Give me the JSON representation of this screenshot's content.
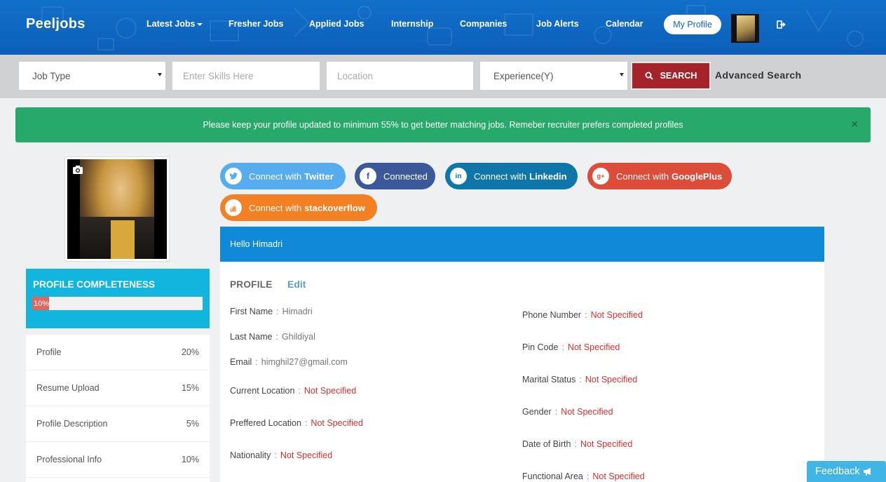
{
  "nav": {
    "brand": "Peeljobs",
    "items": [
      "Latest Jobs",
      "Fresher Jobs",
      "Applied Jobs",
      "Internship",
      "Companies",
      "Job Alerts",
      "Calendar"
    ],
    "active": "My Profile",
    "icons": {
      "logout": "logout-icon",
      "dropdown": "caret-down-icon"
    }
  },
  "search": {
    "job_type": "Job Type",
    "skills_placeholder": "Enter Skills Here",
    "location_placeholder": "Location",
    "experience": "Experience(Y)",
    "button": "SEARCH",
    "advanced": "Advanced Search",
    "button_color": "#a5232a"
  },
  "alert": {
    "message": "Please keep your profile updated to minimum 55% to get better matching jobs. Remeber recruiter prefers completed profiles",
    "close": "×",
    "color": "#27a96b"
  },
  "completeness": {
    "title": "PROFILE COMPLETENESS",
    "percent_label": "10%",
    "percent": 10,
    "color": "#12b5dd"
  },
  "progress_items": [
    {
      "label": "Profile",
      "value": "20%"
    },
    {
      "label": "Resume Upload",
      "value": "15%"
    },
    {
      "label": "Profile Description",
      "value": "5%"
    },
    {
      "label": "Professional Info",
      "value": "10%"
    }
  ],
  "social": {
    "twitter": {
      "prefix": "Connect with",
      "name": "Twitter",
      "color": "#55acee",
      "icon": "twitter-icon"
    },
    "facebook": {
      "label": "Connected",
      "color": "#3b5998",
      "icon": "facebook-icon"
    },
    "linkedin": {
      "prefix": "Connect with",
      "name": "Linkedin",
      "color": "#0e76a8",
      "icon": "linkedin-icon"
    },
    "google": {
      "prefix": "Connect with",
      "name": "GooglePlus",
      "color": "#dd4b39",
      "icon": "google-plus-icon"
    },
    "stackoverflow": {
      "prefix": "Connect with",
      "name": "stackoverflow",
      "color": "#f48024",
      "icon": "stackoverflow-icon"
    }
  },
  "hello": "Hello Himadri",
  "profile": {
    "title": "PROFILE",
    "edit": "Edit",
    "left": [
      {
        "key": "First Name",
        "value": "Himadri"
      },
      {
        "key": "Last Name",
        "value": "Ghildiyal"
      },
      {
        "key": "Email",
        "value": "himghil27@gmail.com"
      },
      {
        "key": "Current Location",
        "value": "Not Specified"
      },
      {
        "key": "Preffered Location",
        "value": "Not Specified"
      },
      {
        "key": "Nationality",
        "value": "Not Specified"
      }
    ],
    "right": [
      {
        "key": "Phone Number",
        "value": "Not Specified"
      },
      {
        "key": "Pin Code",
        "value": "Not Specified"
      },
      {
        "key": "Marital Status",
        "value": "Not Specified"
      },
      {
        "key": "Gender",
        "value": "Not Specified"
      },
      {
        "key": "Date of Birth",
        "value": "Not Specified"
      },
      {
        "key": "Functional Area",
        "value": "Not Specified"
      }
    ],
    "separator": ":",
    "not_specified_color": "#d9302b"
  },
  "feedback": "Feedback"
}
